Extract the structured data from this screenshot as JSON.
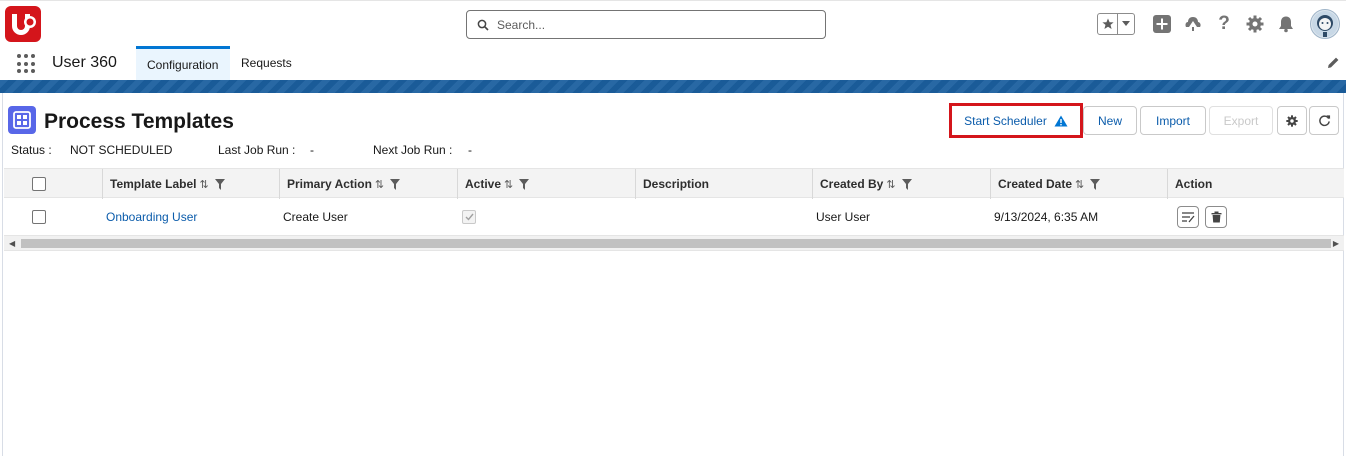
{
  "header": {
    "search_placeholder": "Search...",
    "icons": [
      "favorites-star-icon",
      "favorites-dropdown-icon",
      "global-actions-add-icon",
      "trailhead-icon",
      "help-icon",
      "setup-gear-icon",
      "notifications-bell-icon",
      "user-avatar"
    ]
  },
  "nav": {
    "app_name": "User 360",
    "tabs": [
      {
        "label": "Configuration",
        "active": true
      },
      {
        "label": "Requests",
        "active": false
      }
    ]
  },
  "page": {
    "title": "Process Templates",
    "status_label": "Status :",
    "status_value": "NOT SCHEDULED",
    "last_run_label": "Last Job Run :",
    "last_run_value": "-",
    "next_run_label": "Next Job Run :",
    "next_run_value": "-"
  },
  "buttons": {
    "start_scheduler": "Start Scheduler",
    "new": "New",
    "import": "Import",
    "export": "Export"
  },
  "colors": {
    "brand_red": "#d4151b",
    "link_blue": "#0b5cab",
    "accent_blue": "#0176d3",
    "warning_icon_blue": "#0176d3"
  },
  "table": {
    "columns": [
      "Template Label",
      "Primary Action",
      "Active",
      "Description",
      "Created By",
      "Created Date",
      "Action"
    ],
    "rows": [
      {
        "label": "Onboarding User",
        "primary_action": "Create User",
        "active": true,
        "description": "",
        "created_by": "User User",
        "created_date": "9/13/2024, 6:35 AM"
      }
    ]
  }
}
